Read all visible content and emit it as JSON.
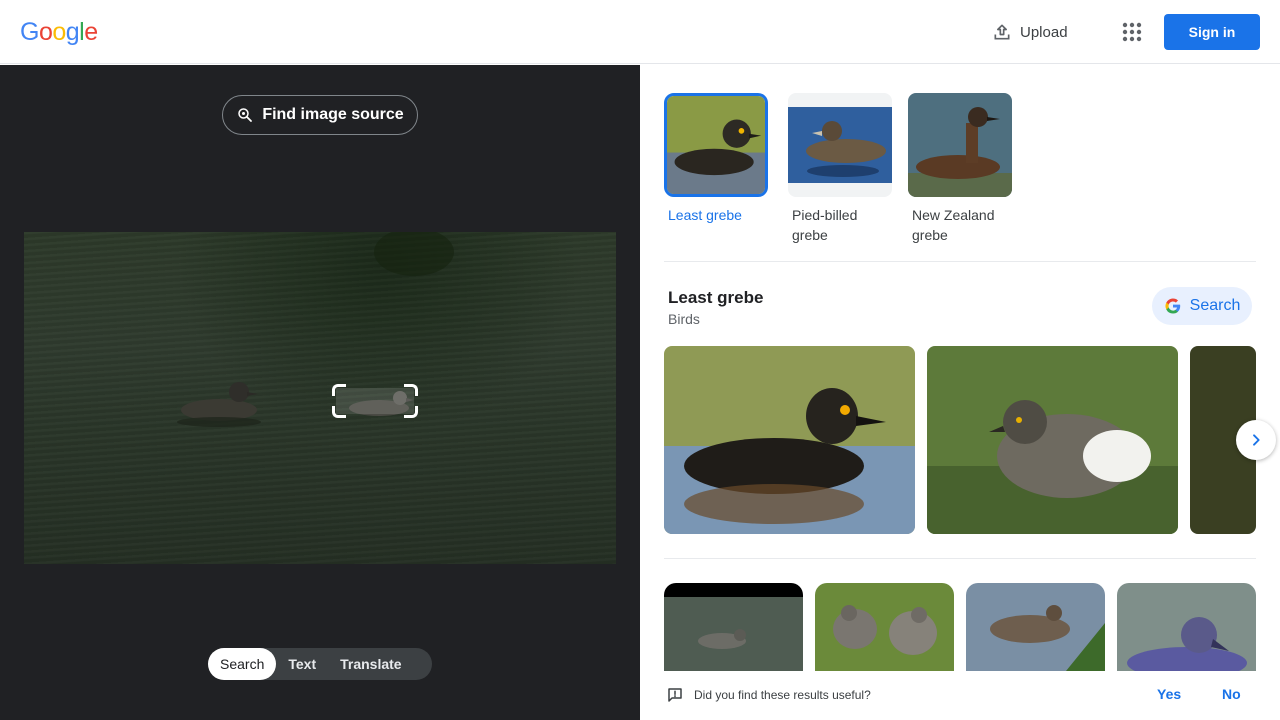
{
  "header": {
    "logo_letters": [
      "G",
      "o",
      "o",
      "g",
      "l",
      "e"
    ],
    "logo_colors": [
      "#4285f4",
      "#ea4335",
      "#fbbc05",
      "#4285f4",
      "#34a853",
      "#ea4335"
    ],
    "upload_label": "Upload",
    "apps_icon": "apps-grid-icon",
    "signin_label": "Sign in"
  },
  "left_panel": {
    "find_source_label": "Find image source",
    "modes": [
      {
        "label": "Search",
        "active": true
      },
      {
        "label": "Text",
        "active": false
      },
      {
        "label": "Translate",
        "active": false
      }
    ]
  },
  "right_panel": {
    "chips": [
      {
        "label": "Least grebe",
        "selected": true
      },
      {
        "label": "Pied-billed grebe",
        "selected": false
      },
      {
        "label": "New Zealand grebe",
        "selected": false
      }
    ],
    "knowledge": {
      "title": "Least grebe",
      "subtitle": "Birds",
      "search_label": "Search"
    },
    "feedback": {
      "question": "Did you find these results useful?",
      "yes": "Yes",
      "no": "No"
    }
  },
  "colors": {
    "accent": "#1a73e8",
    "dark_panel": "#202124"
  }
}
